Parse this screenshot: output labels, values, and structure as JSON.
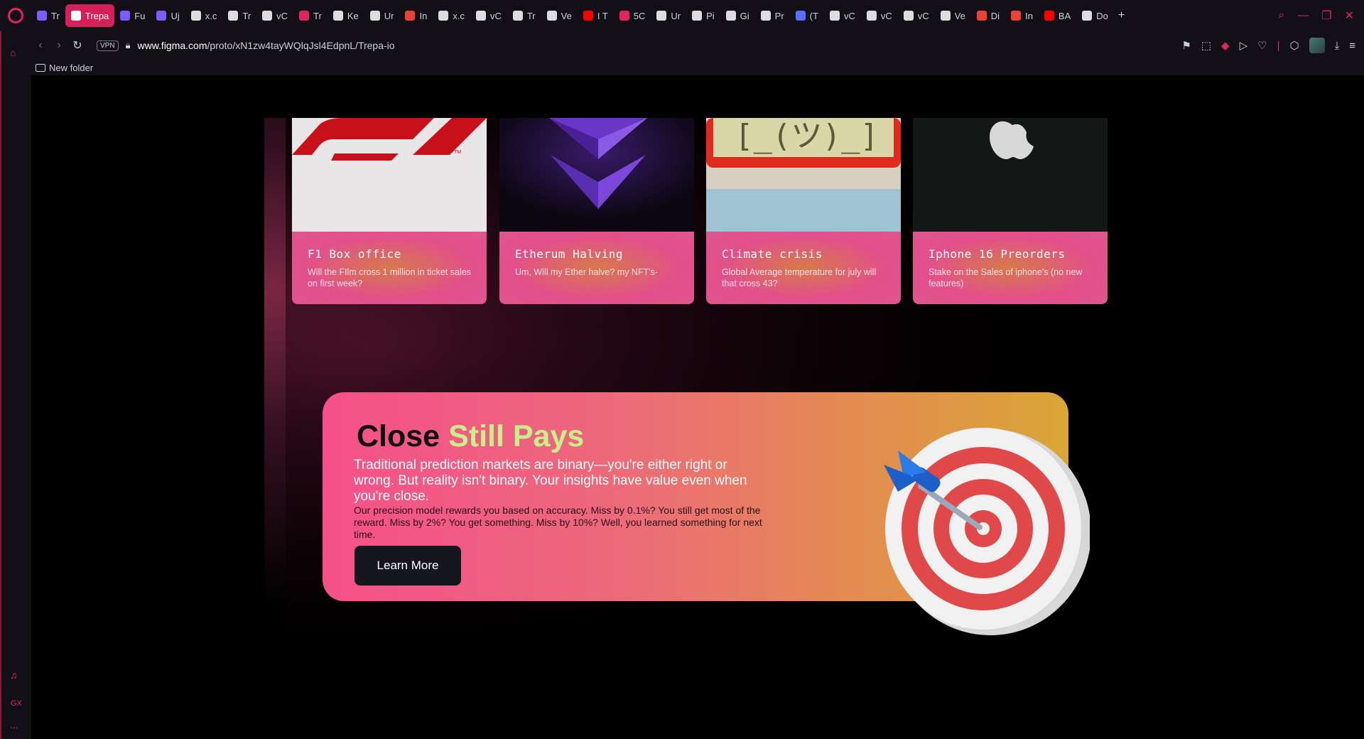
{
  "browser": {
    "tabs": [
      {
        "label": "Tr",
        "color": "#7b5cff"
      },
      {
        "label": "Trepa",
        "color": "#f24e1e",
        "active": true
      },
      {
        "label": "Fu",
        "color": "#7b5cff"
      },
      {
        "label": "Uj",
        "color": "#7b5cff"
      },
      {
        "label": "x.c",
        "color": "#ddd"
      },
      {
        "label": "Tr",
        "color": "#ddd"
      },
      {
        "label": "vC",
        "color": "#ddd"
      },
      {
        "label": "Tr",
        "color": "#e0245e"
      },
      {
        "label": "Ke",
        "color": "#ddd"
      },
      {
        "label": "Ur",
        "color": "#ddd"
      },
      {
        "label": "In",
        "color": "#ea4335"
      },
      {
        "label": "x.c",
        "color": "#ddd"
      },
      {
        "label": "vC",
        "color": "#ddd"
      },
      {
        "label": "Tr",
        "color": "#ddd"
      },
      {
        "label": "Ve",
        "color": "#ddd"
      },
      {
        "label": "I T",
        "color": "#ff0000"
      },
      {
        "label": "5C",
        "color": "#e0245e"
      },
      {
        "label": "Ur",
        "color": "#ddd"
      },
      {
        "label": "Pi",
        "color": "#ddd"
      },
      {
        "label": "Gi",
        "color": "#ddd"
      },
      {
        "label": "Pr",
        "color": "#ddd"
      },
      {
        "label": "(T",
        "color": "#5b6cff"
      },
      {
        "label": "vC",
        "color": "#ddd"
      },
      {
        "label": "vC",
        "color": "#ddd"
      },
      {
        "label": "vC",
        "color": "#ddd"
      },
      {
        "label": "Ve",
        "color": "#ddd"
      },
      {
        "label": "Di",
        "color": "#ea4335"
      },
      {
        "label": "In",
        "color": "#ea4335"
      },
      {
        "label": "BA",
        "color": "#ff0000"
      },
      {
        "label": "Do",
        "color": "#ddd"
      }
    ],
    "new_tab": "+",
    "vpn_label": "VPN",
    "url_host": "www.figma.com",
    "url_path": "/proto/xN1zw4tayWQlqJsl4EdpnL/Trepa-io",
    "bookmark": "New folder",
    "sidebar_gx": "GX",
    "sidebar_more": "..."
  },
  "cards": [
    {
      "title": "F1 Box office",
      "desc": "Will the FIlm cross 1 million in ticket sales on first week?",
      "image": "f1-logo"
    },
    {
      "title": "Etherum Halving",
      "desc": "Um, Will my Ether halve? my NFT's-",
      "image": "ethereum-logo"
    },
    {
      "title": "Climate crisis",
      "desc": "Global Average temperature for july will that cross 43?",
      "image": "sad-thermometer"
    },
    {
      "title": "Iphone 16 Preorders",
      "desc": "Stake on the Sales of iphone's (no new features)",
      "image": "apple-logo"
    }
  ],
  "banner": {
    "headline_a": "Close",
    "headline_b": "Still Pays",
    "lead": "Traditional prediction markets are binary—you're either right or wrong. But reality isn't binary. Your insights have value even when you're close.",
    "fine": "Our precision model rewards you based on accuracy. Miss by 0.1%? You still get most of the reward. Miss by 2%? You get something. Miss by 10%? Well, you learned something for next time.",
    "button": "Learn More"
  },
  "colors": {
    "accent": "#e0245e",
    "headline_accent": "#c8f08a"
  }
}
